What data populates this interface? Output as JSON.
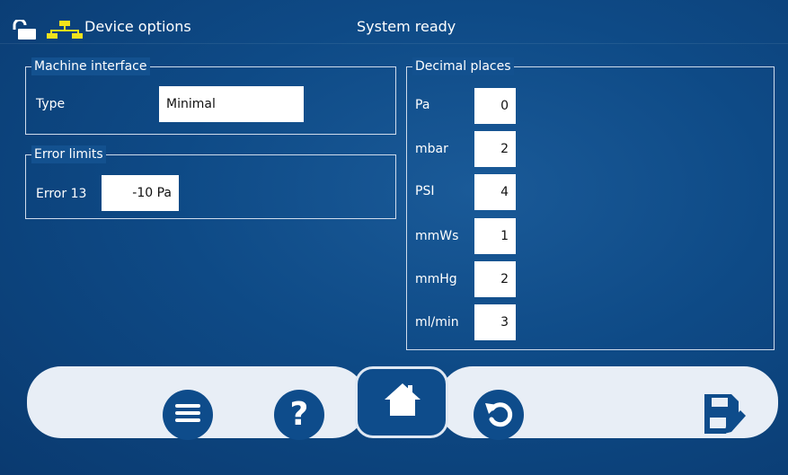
{
  "header": {
    "title": "Device options",
    "status": "System ready",
    "icons": [
      "unlock-icon",
      "network-icon"
    ]
  },
  "machine_interface": {
    "title": "Machine interface",
    "type_label": "Type",
    "type_value": "Minimal"
  },
  "error_limits": {
    "title": "Error limits",
    "error13_label": "Error 13",
    "error13_value": "-10 Pa"
  },
  "decimal_places": {
    "title": "Decimal places",
    "rows": [
      {
        "label": "Pa",
        "value": "0"
      },
      {
        "label": "mbar",
        "value": "2"
      },
      {
        "label": "PSI",
        "value": "4"
      },
      {
        "label": "mmWs",
        "value": "1"
      },
      {
        "label": "mmHg",
        "value": "2"
      },
      {
        "label": "ml/min",
        "value": "3"
      }
    ]
  },
  "toolbar": {
    "buttons": [
      "menu-icon",
      "help-icon",
      "home-icon",
      "undo-icon",
      "save-edit-icon"
    ]
  },
  "colors": {
    "background": "#0e4a86",
    "accent_yellow": "#f2e21c",
    "button_blue": "#0e4c8b",
    "toolbar_bg": "#e8eef6"
  }
}
